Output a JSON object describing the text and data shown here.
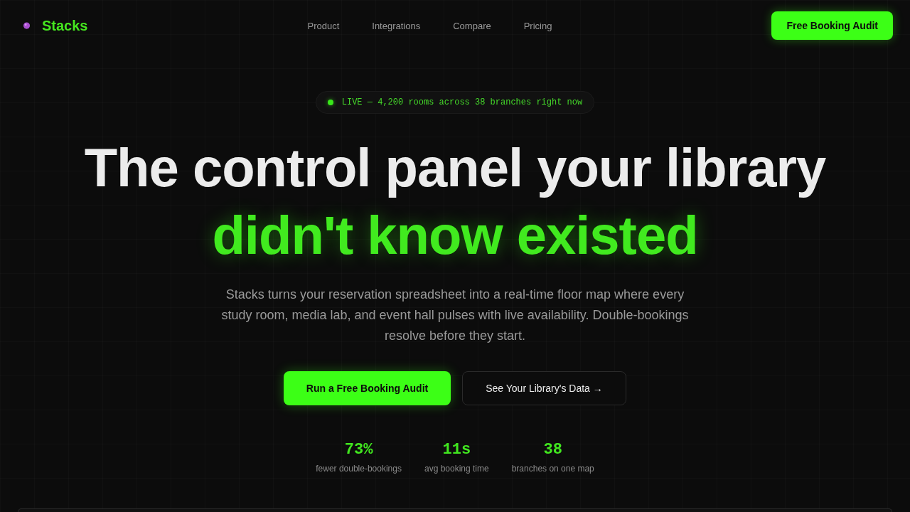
{
  "nav": {
    "logo": "Stacks",
    "links": [
      "Product",
      "Integrations",
      "Compare",
      "Pricing"
    ],
    "cta": "Free Booking Audit"
  },
  "hero": {
    "badge": "LIVE — 4,200 rooms across 38 branches right now",
    "headline": "The control panel your library",
    "headline_highlight": "didn't know existed",
    "description": "Stacks turns your reservation spreadsheet into a real-time floor map where every study room, media lab, and event hall pulses with live availability. Double-bookings resolve before they start.",
    "buttons": [
      {
        "label": "Run a Free Booking Audit",
        "kind": "primary"
      },
      {
        "label": "See Your Library's Data →",
        "kind": "secondary"
      }
    ],
    "stats": [
      {
        "value": "73%",
        "label": "fewer double-bookings"
      },
      {
        "value": "11s",
        "label": "avg booking time"
      },
      {
        "value": "38",
        "label": "branches on one map"
      }
    ]
  }
}
